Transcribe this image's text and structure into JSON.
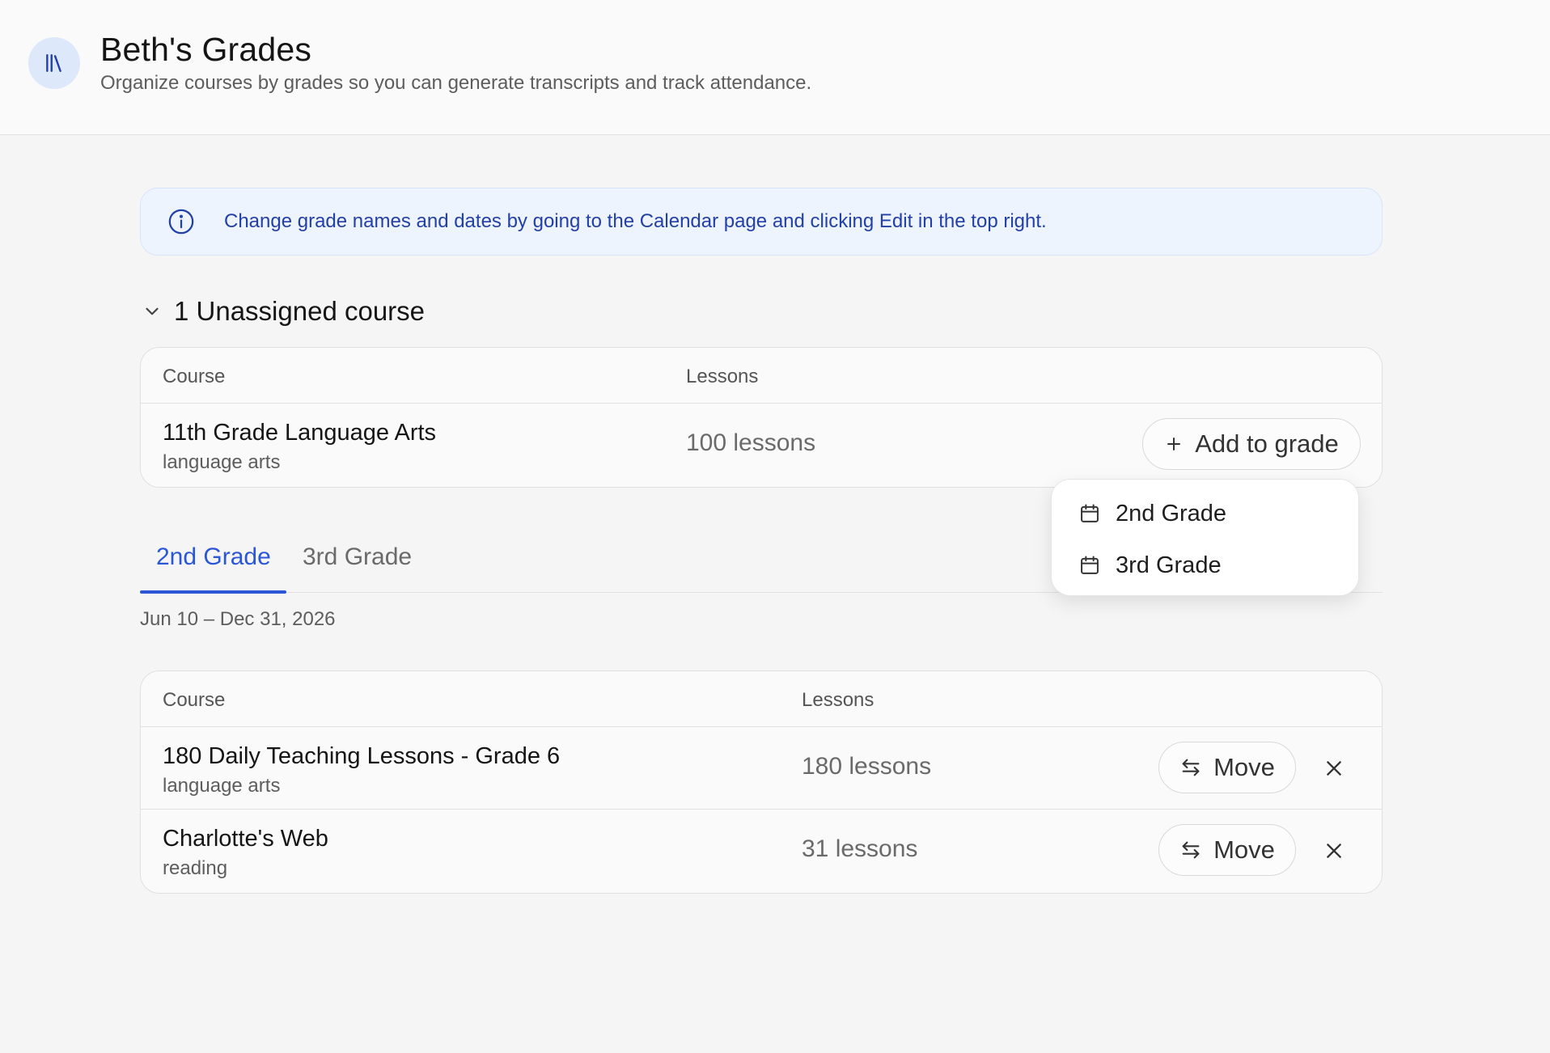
{
  "header": {
    "title": "Beth's Grades",
    "subtitle": "Organize courses by grades so you can generate transcripts and track attendance.",
    "logo_icon": "library-books-icon"
  },
  "info_banner": {
    "icon": "info-icon",
    "text": "Change grade names and dates by going to the Calendar page and clicking Edit in the top right."
  },
  "unassigned": {
    "title": "1 Unassigned course",
    "columns": {
      "course": "Course",
      "lessons": "Lessons"
    },
    "rows": [
      {
        "name": "11th Grade Language Arts",
        "subject": "language arts",
        "lessons": "100 lessons",
        "action": "Add to grade"
      }
    ]
  },
  "grade_dropdown": {
    "options": [
      "2nd Grade",
      "3rd Grade"
    ]
  },
  "tabs": {
    "items": [
      "2nd Grade",
      "3rd Grade"
    ],
    "active": "2nd Grade"
  },
  "grade": {
    "date_range": "Jun 10 – Dec 31, 2026",
    "columns": {
      "course": "Course",
      "lessons": "Lessons"
    },
    "rows": [
      {
        "name": "180 Daily Teaching Lessons - Grade 6",
        "subject": "language arts",
        "lessons": "180 lessons",
        "action": "Move"
      },
      {
        "name": "Charlotte's Web",
        "subject": "reading",
        "lessons": "31 lessons",
        "action": "Move"
      }
    ]
  },
  "colors": {
    "accent": "#2b57d6",
    "banner_bg": "#eef4fe",
    "banner_text": "#2340a8"
  }
}
